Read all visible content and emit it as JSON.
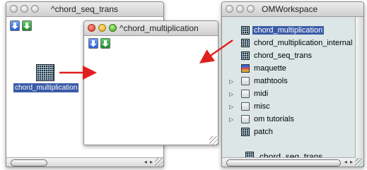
{
  "windows": {
    "seq_trans": {
      "title": "^chord_seq_trans",
      "box_label": "chord_multiplication",
      "down_icon": "blue-down-arrow-icon",
      "up_icon": "green-up-arrow-icon"
    },
    "chord_mult": {
      "title": "^chord_multiplication",
      "down_icon": "blue-down-arrow-icon",
      "up_icon": "green-up-arrow-icon"
    },
    "workspace": {
      "title": "OMWorkspace",
      "items": [
        {
          "label": "chord_multiplication",
          "icon": "patch-grid-icon",
          "disclosure": false,
          "selected": true
        },
        {
          "label": "chord_multiplication_internal",
          "icon": "patch-grid-icon",
          "disclosure": false
        },
        {
          "label": "chord_seq_trans",
          "icon": "patch-grid-icon",
          "disclosure": false
        },
        {
          "label": "maquette",
          "icon": "maquette-icon",
          "disclosure": false
        },
        {
          "label": "mathtools",
          "icon": "folder-icon",
          "disclosure": true
        },
        {
          "label": "midi",
          "icon": "folder-icon",
          "disclosure": true
        },
        {
          "label": "misc",
          "icon": "folder-icon",
          "disclosure": true
        },
        {
          "label": "om tutorials",
          "icon": "folder-icon",
          "disclosure": true
        },
        {
          "label": "patch",
          "icon": "patch-grid-icon",
          "disclosure": false
        }
      ],
      "drag_item": {
        "label": "chord_seq_trans",
        "icon": "patch-grid-icon"
      }
    }
  },
  "colors": {
    "selection": "#3b5ba7",
    "arrow": "#e02020",
    "workspace_bg": "#dce6e6"
  }
}
